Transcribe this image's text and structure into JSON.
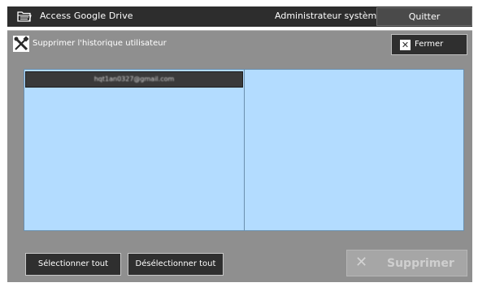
{
  "topbar": {
    "app_title": "Access Google Drive",
    "user_label": "Administrateur système",
    "quit_label": "Quitter",
    "app_icon": "folder-icon"
  },
  "dialog": {
    "title": "Supprimer l'historique utilisateur",
    "tool_icon": "tools-icon",
    "close_label": "Fermer",
    "close_icon": "close-icon"
  },
  "list": {
    "items": [
      {
        "label": "hqt1an0327@gmail.com",
        "selected": true
      }
    ]
  },
  "actions": {
    "select_all_label": "Sélectionner tout",
    "deselect_all_label": "Désélectionner tout",
    "delete_label": "Supprimer",
    "delete_enabled": false
  },
  "colors": {
    "topbar_bg": "#2d2d2d",
    "panel_bg": "#8f8f8f",
    "list_bg": "#b3dcff",
    "selected_row_bg": "#3a3a3a",
    "button_bg": "#2f2f2f",
    "disabled_button_bg": "#a6a6a6"
  }
}
